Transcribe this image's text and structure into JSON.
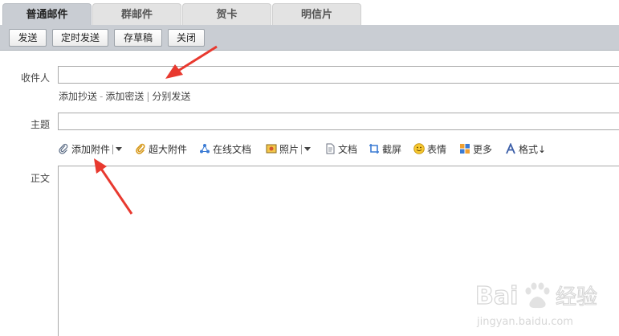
{
  "tabs": [
    {
      "label": "普通邮件",
      "active": true
    },
    {
      "label": "群邮件",
      "active": false
    },
    {
      "label": "贺卡",
      "active": false
    },
    {
      "label": "明信片",
      "active": false
    }
  ],
  "toolbar": {
    "send_label": "发送",
    "schedule_label": "定时发送",
    "draft_label": "存草稿",
    "close_label": "关闭"
  },
  "form": {
    "recipient_label": "收件人",
    "recipient_value": "",
    "add_cc": "添加抄送",
    "add_bcc": "添加密送",
    "separate_send": "分别发送",
    "dash": "-",
    "bar": "|",
    "subject_label": "主题",
    "subject_value": "",
    "body_label": "正文",
    "body_value": ""
  },
  "attachments": {
    "add_attachment": "添加附件",
    "large_attachment": "超大附件",
    "online_doc": "在线文档",
    "photo": "照片",
    "document": "文档",
    "screenshot": "截屏",
    "emoji": "表情",
    "more": "更多",
    "format": "格式↓"
  },
  "watermark": {
    "brand": "Bai 经验",
    "url": "jingyan.baidu.com"
  },
  "colors": {
    "toolbar_bg": "#c9cdd3",
    "arrow": "#e8392f",
    "link": "#444444"
  }
}
